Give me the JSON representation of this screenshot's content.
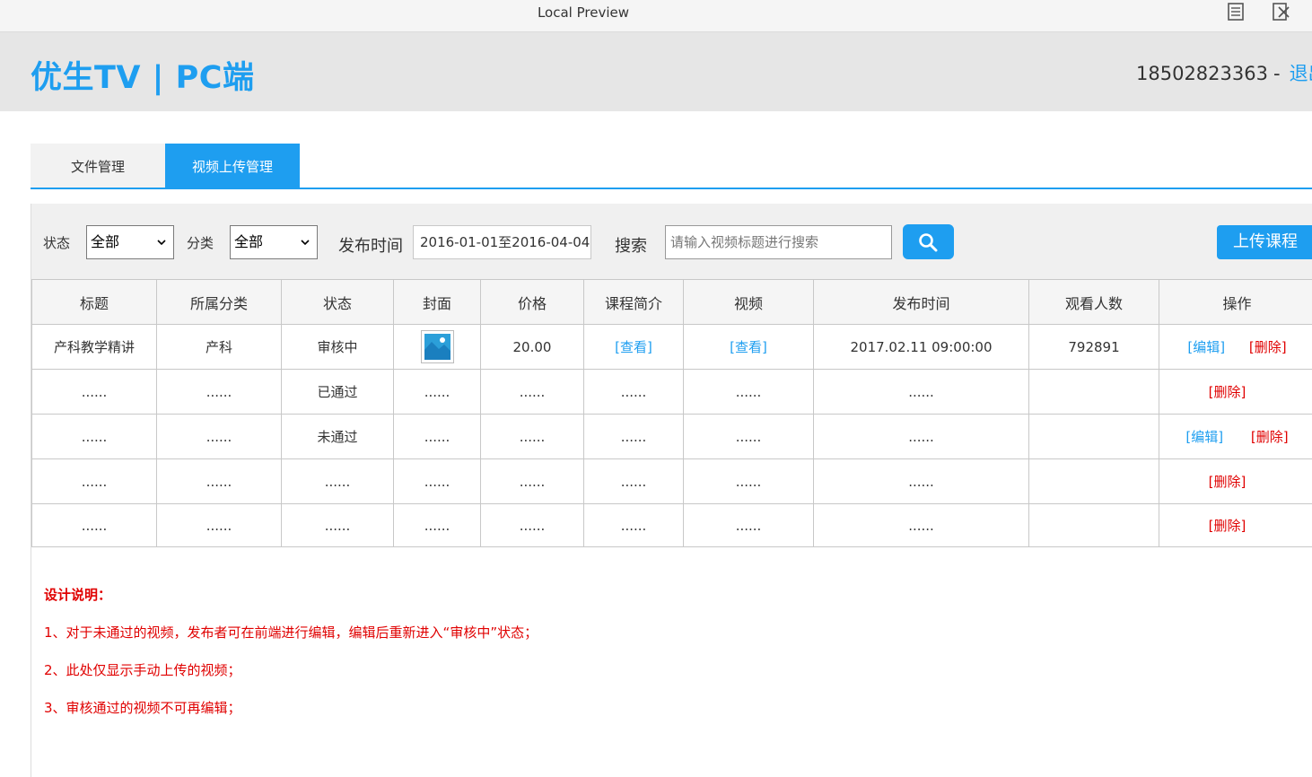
{
  "window": {
    "title": "Local Preview",
    "icons": [
      "document-icon",
      "external-icon"
    ]
  },
  "header": {
    "brand": "优生TV | PC端",
    "phone": "18502823363",
    "separator": "-",
    "logout": "退出"
  },
  "tabs": [
    {
      "label": "文件管理",
      "active": false
    },
    {
      "label": "视频上传管理",
      "active": true
    }
  ],
  "filters": {
    "status_label": "状态",
    "status_value": "全部",
    "category_label": "分类",
    "category_value": "全部",
    "time_label": "发布时间",
    "time_value": "2016-01-01至2016-04-04",
    "search_label": "搜索",
    "search_placeholder": "请输入视频标题进行搜索",
    "upload_label": "上传课程"
  },
  "table": {
    "headers": [
      "标题",
      "所属分类",
      "状态",
      "封面",
      "价格",
      "课程简介",
      "视频",
      "发布时间",
      "观看人数",
      "操作"
    ],
    "rows": [
      {
        "title": "产科教学精讲",
        "category": "产科",
        "status": "审核中",
        "price": "20.00",
        "intro": "[查看]",
        "video": "[查看]",
        "time": "2017.02.11  09:00:00",
        "views": "792891",
        "edit": "[编辑]",
        "delete": "[删除]"
      },
      {
        "title": "......",
        "category": "......",
        "status": "已通过",
        "cover": "......",
        "price": "......",
        "intro": "......",
        "video": "......",
        "time": "......",
        "delete": "[删除]"
      },
      {
        "title": "......",
        "category": "......",
        "status": "未通过",
        "cover": "......",
        "price": "......",
        "intro": "......",
        "video": "......",
        "time": "......",
        "edit": "[编辑]",
        "delete": "[删除]"
      },
      {
        "title": "......",
        "category": "......",
        "status": "......",
        "cover": "......",
        "price": "......",
        "intro": "......",
        "video": "......",
        "time": "......",
        "delete": "[删除]"
      },
      {
        "title": "......",
        "category": "......",
        "status": "......",
        "cover": "......",
        "price": "......",
        "intro": "......",
        "video": "......",
        "time": "......",
        "delete": "[删除]"
      }
    ]
  },
  "notes": {
    "heading": "设计说明：",
    "items": [
      "1、对于未通过的视频，发布者可在前端进行编辑，编辑后重新进入“审核中”状态；",
      "2、此处仅显示手动上传的视频；",
      "3、审核通过的视频不可再编辑；"
    ]
  },
  "colors": {
    "accent": "#1e9ef0",
    "danger": "#e00000",
    "header_bg": "#e6e6e6"
  }
}
